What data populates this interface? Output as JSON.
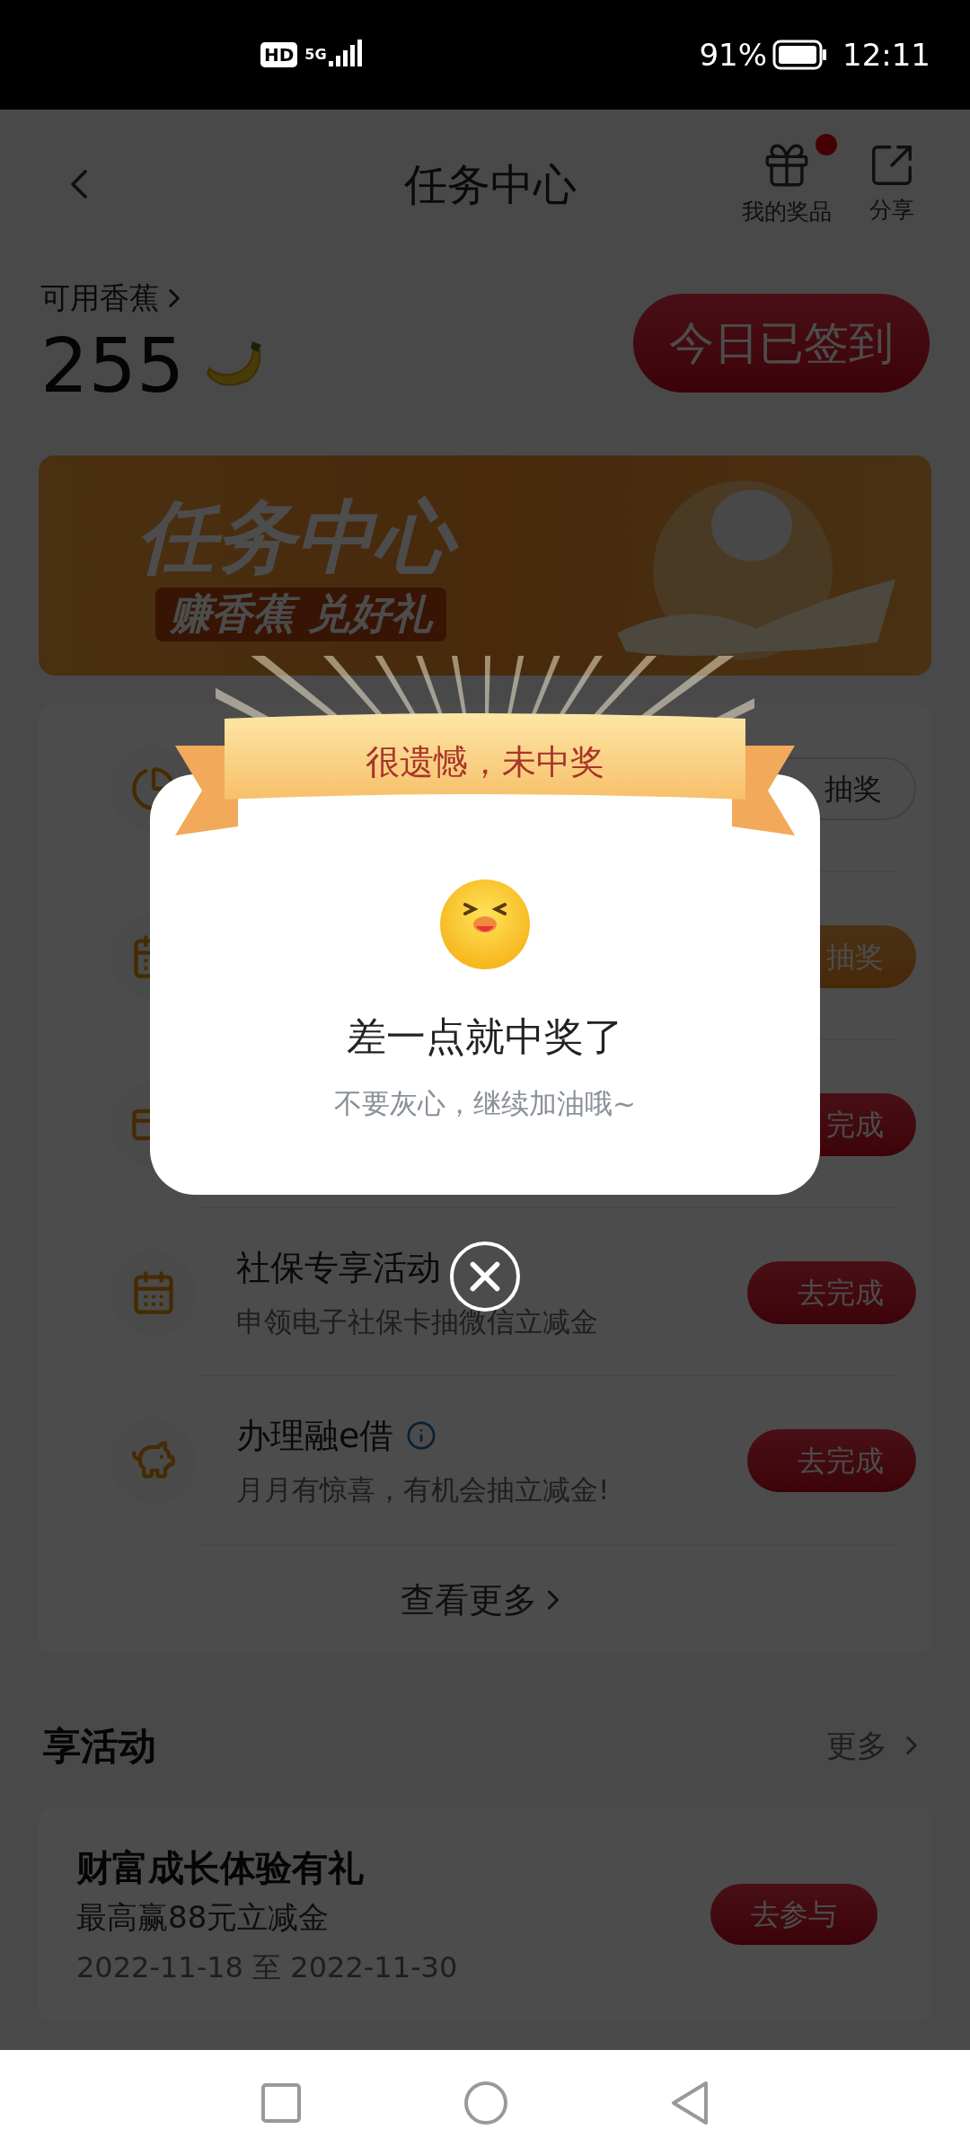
{
  "status_bar": {
    "hd": "HD",
    "network": "5G",
    "battery": "91%",
    "time": "12:11"
  },
  "header": {
    "title": "任务中心",
    "actions": [
      {
        "label": "我的奖品",
        "dot": true
      },
      {
        "label": "分享",
        "dot": false
      }
    ]
  },
  "balance": {
    "label": "可用香蕉",
    "value": "255",
    "sign_button": "今日已签到"
  },
  "banner": {
    "title": "任务中心",
    "subtitle": "赚香蕉 兑好礼"
  },
  "tasks": [
    {
      "button": {
        "kind": "outline",
        "label": "抽奖"
      }
    },
    {
      "button": {
        "kind": "orange",
        "label": "抽奖"
      }
    },
    {
      "button": {
        "kind": "red",
        "label": "完成"
      }
    },
    {
      "title": "社保专享活动",
      "subtitle": "申领电子社保卡抽微信立减金",
      "button": {
        "kind": "red",
        "label": "去完成"
      }
    },
    {
      "title": "办理融e借",
      "info": true,
      "subtitle": "月月有惊喜，有机会抽立减金!",
      "button": {
        "kind": "red",
        "label": "去完成"
      }
    }
  ],
  "more_tasks": "查看更多",
  "activities": {
    "title": "享活动",
    "more": "更多",
    "cards": [
      {
        "title": "财富成长体验有礼",
        "subtitle": "最高赢88元立减金",
        "dates": "2022-11-18 至 2022-11-30",
        "button": "去参与"
      }
    ]
  },
  "dialog": {
    "ribbon": "很遗憾，未中奖",
    "heading": "差一点就中奖了",
    "message": "不要灰心，继续加油哦~"
  }
}
